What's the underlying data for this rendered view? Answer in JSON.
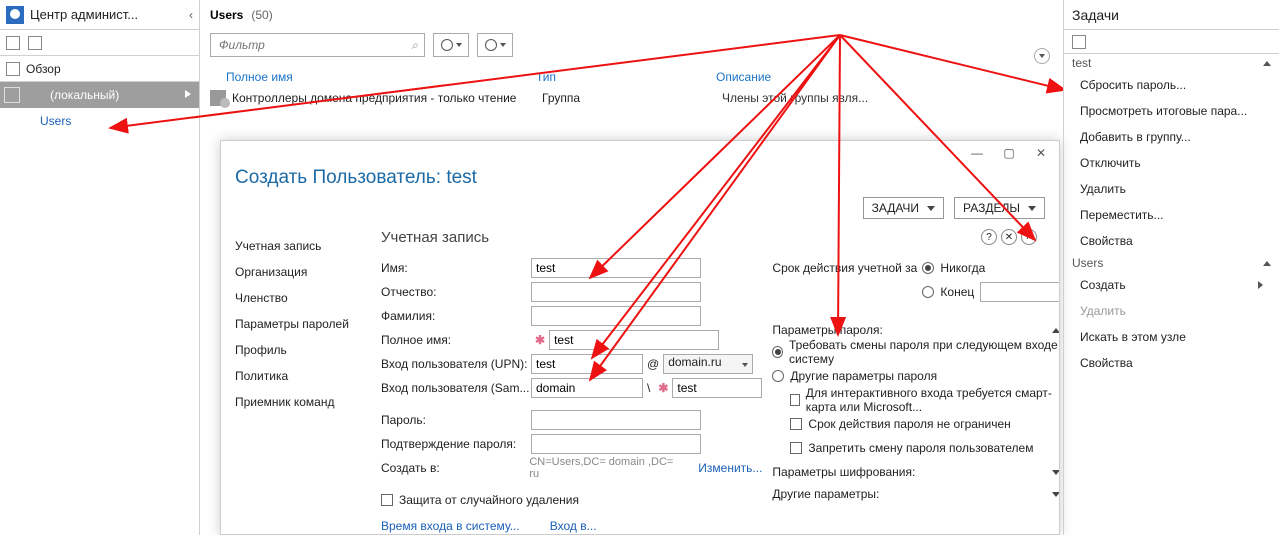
{
  "left": {
    "title": "Центр админист...",
    "obzor": "Обзор",
    "local": "(локальный)",
    "users": "Users"
  },
  "main": {
    "title": "Users",
    "count": "(50)",
    "filter_placeholder": "Фильтр",
    "cols": {
      "name": "Полное имя",
      "type": "Тип",
      "desc": "Описание"
    },
    "row": {
      "name": "Контроллеры домена предприятия - только чтение",
      "type": "Группа",
      "desc": "Члены этой группы явля..."
    }
  },
  "dialog": {
    "title": "Создать Пользователь: test",
    "btn_tasks": "ЗАДАЧИ",
    "btn_sections": "РАЗДЕЛЫ",
    "nav": {
      "account": "Учетная запись",
      "org": "Организация",
      "membership": "Членство",
      "pwd": "Параметры паролей",
      "profile": "Профиль",
      "policy": "Политика",
      "cmd": "Приемник команд"
    },
    "pane_title": "Учетная запись",
    "labels": {
      "first": "Имя:",
      "middle": "Отчество:",
      "last": "Фамилия:",
      "full": "Полное имя:",
      "upn": "Вход пользователя (UPN):",
      "sam": "Вход пользователя (Sam...",
      "pwd": "Пароль:",
      "pwd2": "Подтверждение пароля:",
      "create_in": "Создать в:",
      "protect": "Защита от случайного удаления",
      "logon_hours": "Время входа в систему...",
      "logon_to": "Вход в...",
      "expires": "Срок действия учетной за",
      "never": "Никогда",
      "end": "Конец",
      "pwdopts": "Параметры пароля:",
      "must_change": "Требовать смены пароля при следующем входе в систему",
      "other_pwd": "Другие параметры пароля",
      "smartcard": "Для интерактивного входа требуется смарт-карта или Microsoft...",
      "noexpire": "Срок действия пароля не ограничен",
      "cantchange": "Запретить смену пароля пользователем",
      "encrypt": "Параметры шифрования:",
      "otherparams": "Другие параметры:"
    },
    "vals": {
      "first": "test",
      "full": "test",
      "upn": "test",
      "upn_suffix": "domain.ru",
      "sam_domain": "domain",
      "sam_user": "test",
      "dn": "CN=Users,DC= domain ,DC= ru",
      "change": "Изменить..."
    }
  },
  "tasks": {
    "title": "Задачи",
    "group1": "test",
    "items1": {
      "reset": "Сбросить пароль...",
      "resultant": "Просмотреть итоговые пара...",
      "addgrp": "Добавить в группу...",
      "disable": "Отключить",
      "delete": "Удалить",
      "move": "Переместить...",
      "props": "Свойства"
    },
    "group2": "Users",
    "items2": {
      "create": "Создать",
      "delete": "Удалить",
      "search": "Искать в этом узле",
      "props": "Свойства"
    }
  }
}
